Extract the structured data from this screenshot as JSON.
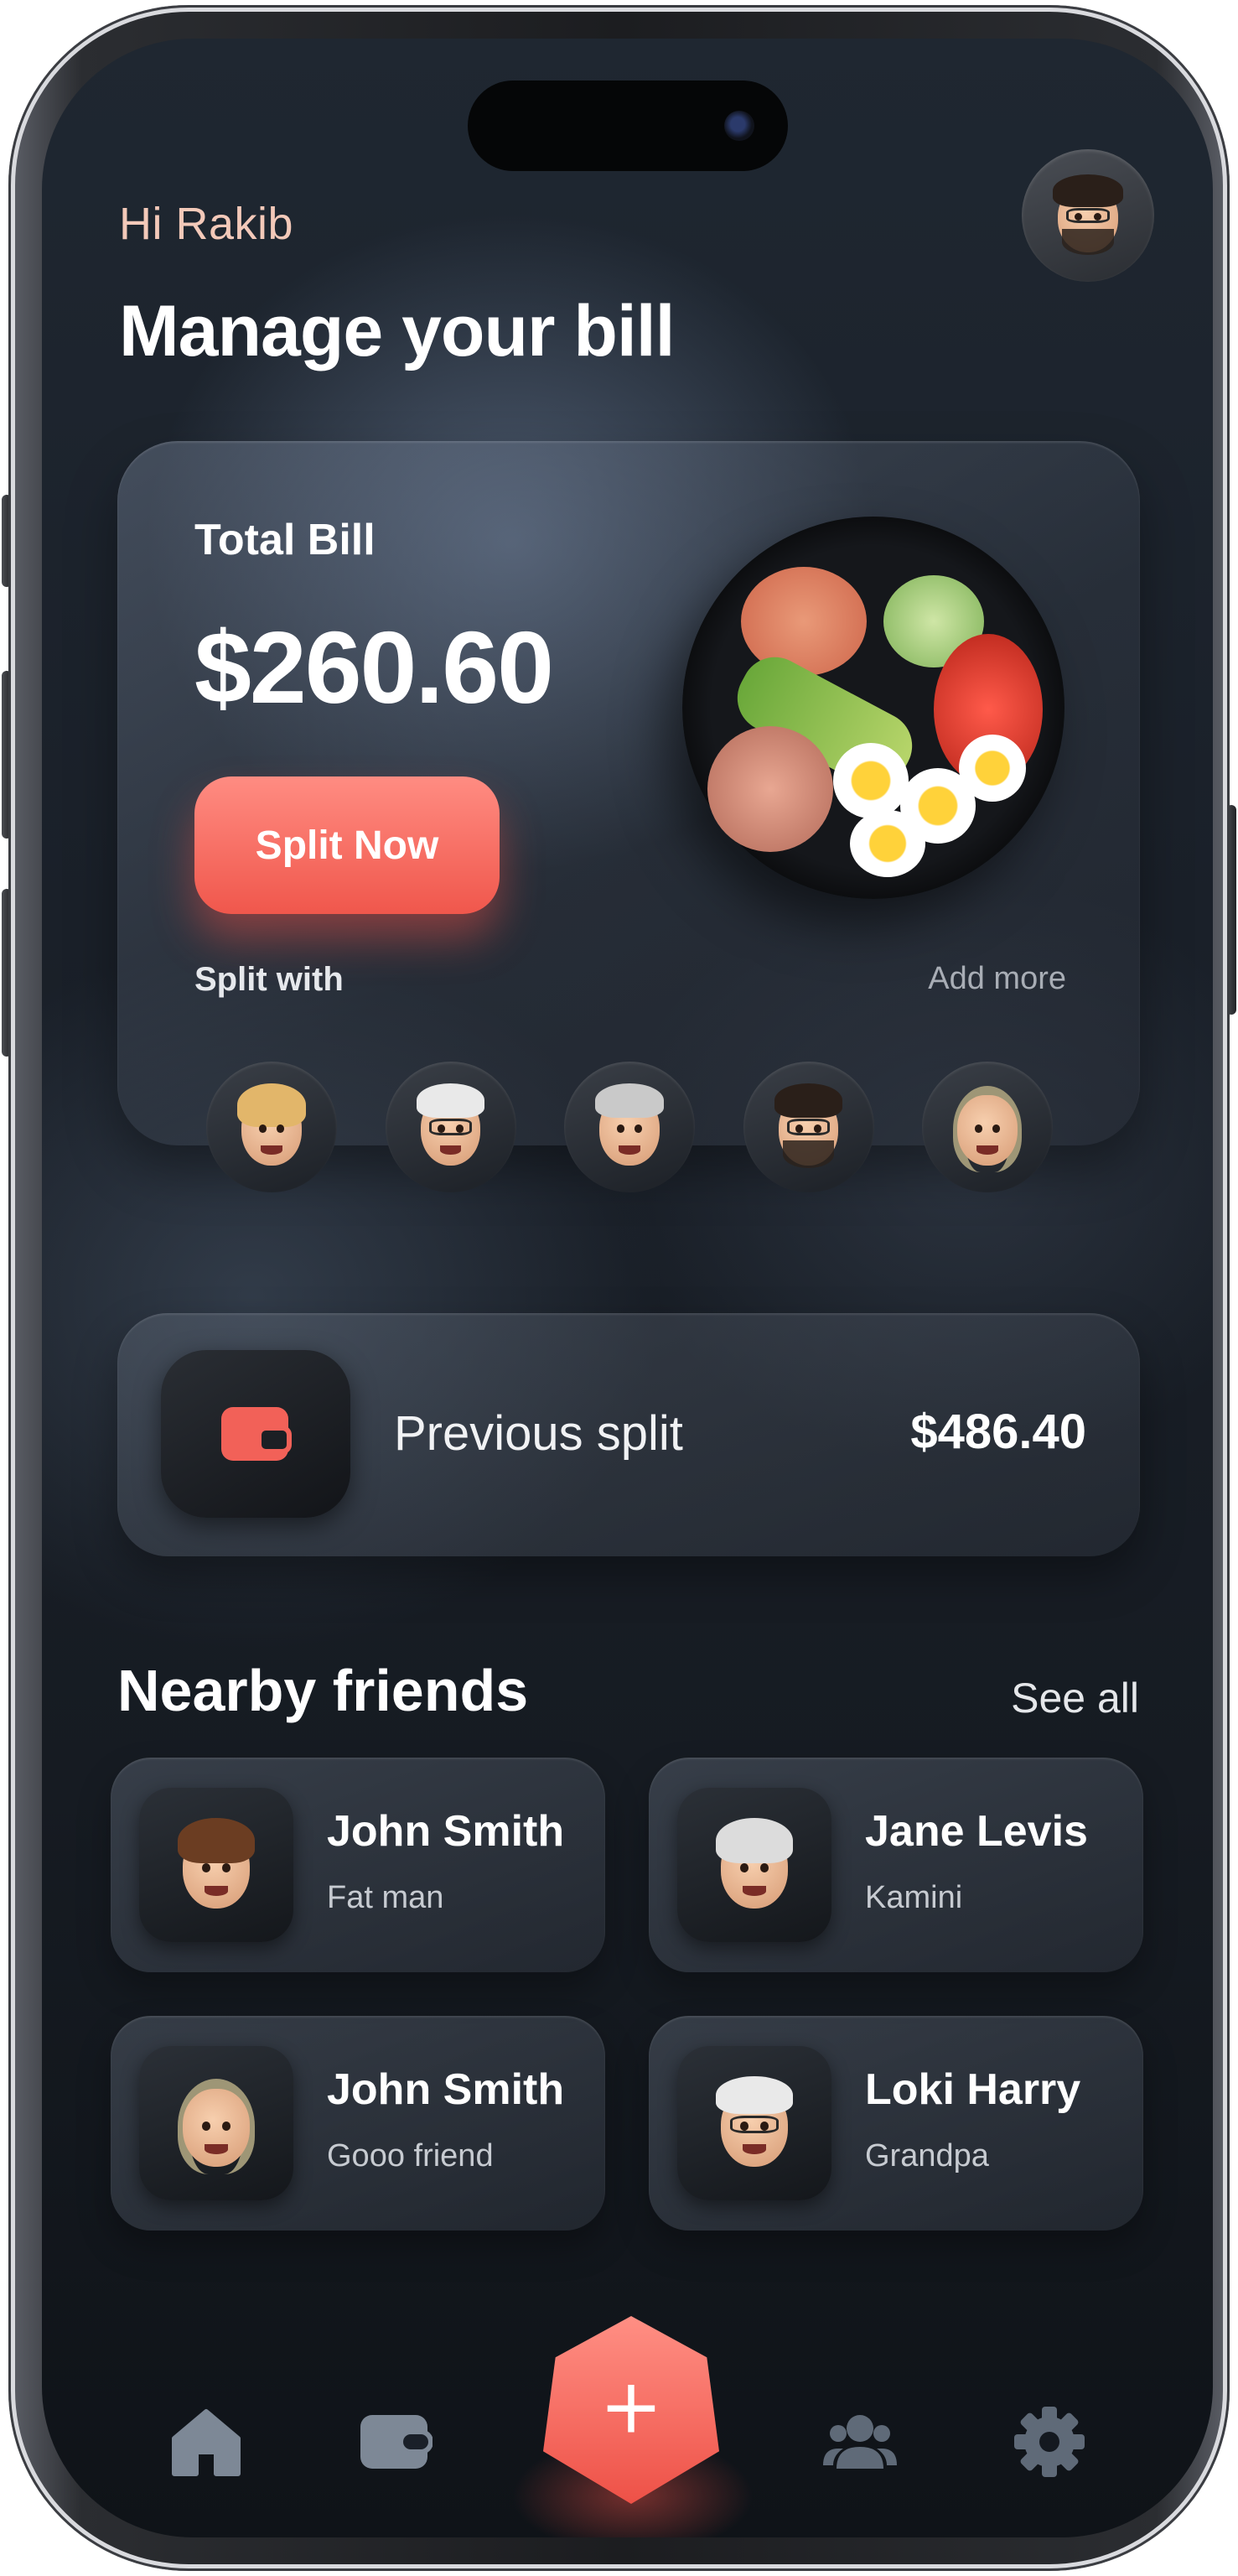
{
  "header": {
    "greeting": "Hi Rakib",
    "title": "Manage your bill"
  },
  "bill": {
    "label": "Total Bill",
    "amount": "$260.60",
    "split_button": "Split Now",
    "split_with_label": "Split with",
    "add_more": "Add more"
  },
  "previous_split": {
    "label": "Previous split",
    "amount": "$486.40",
    "icon": "wallet-icon"
  },
  "nearby": {
    "title": "Nearby friends",
    "see_all": "See all",
    "friends": [
      {
        "name": "John Smith",
        "subtitle": "Fat man"
      },
      {
        "name": "Jane Levis",
        "subtitle": "Kamini"
      },
      {
        "name": "John Smith",
        "subtitle": "Gooo friend"
      },
      {
        "name": "Loki Harry",
        "subtitle": "Grandpa"
      }
    ]
  },
  "tabbar": {
    "items": [
      "home-icon",
      "wallet-icon",
      "plus-icon",
      "users-icon",
      "gear-icon"
    ],
    "fab_label": "+"
  },
  "colors": {
    "accent": "#f0574c",
    "accent_light": "#ff8c82",
    "greeting": "#f3c9b9"
  }
}
